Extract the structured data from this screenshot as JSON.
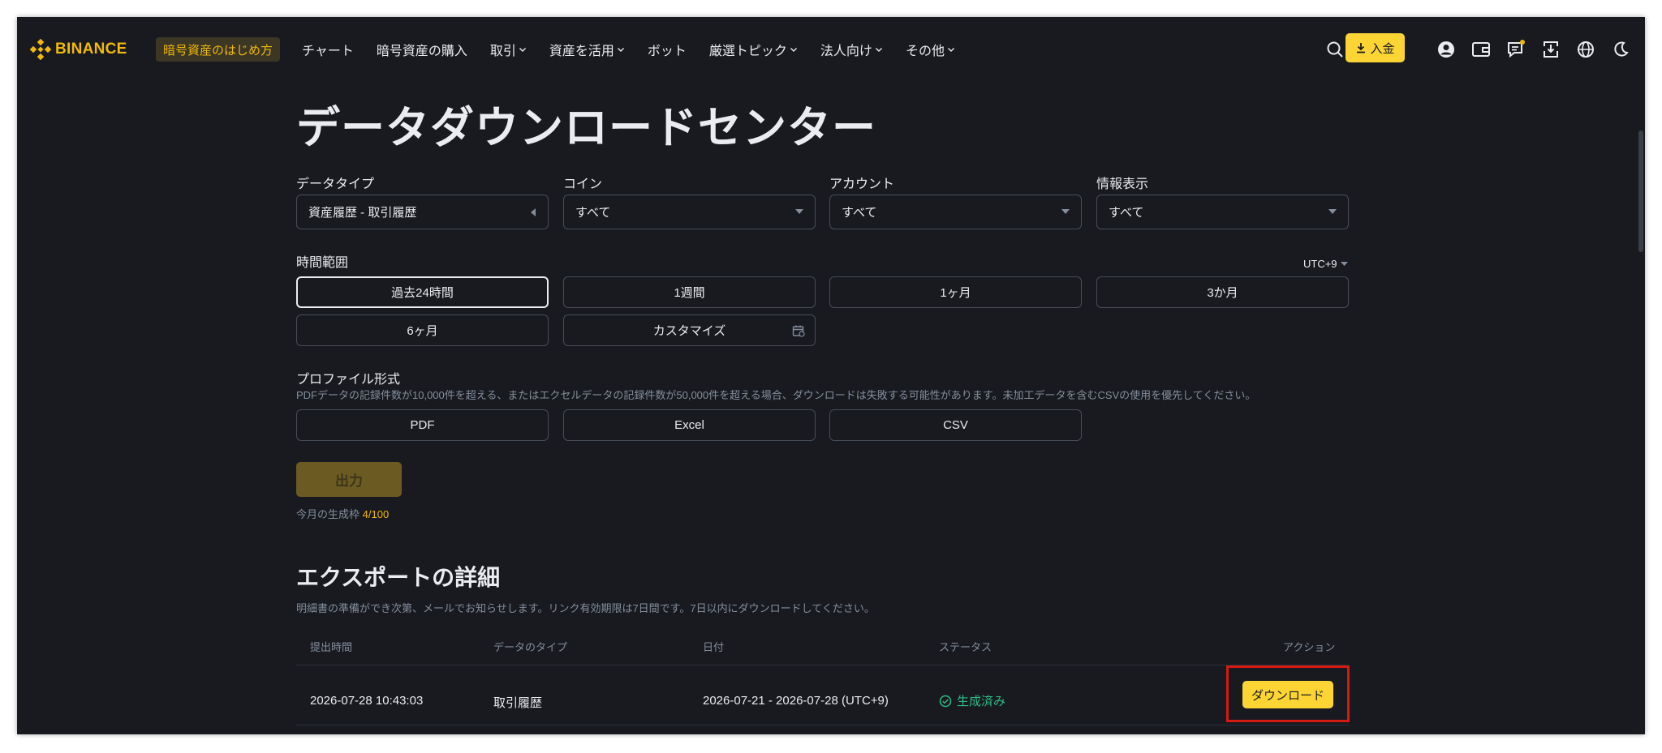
{
  "brand": {
    "name": "BINANCE",
    "color": "#f0b90b"
  },
  "header": {
    "guide_badge": "暗号資産のはじめ方",
    "nav": [
      {
        "label": "チャート",
        "has_chevron": false
      },
      {
        "label": "暗号資産の購入",
        "has_chevron": false
      },
      {
        "label": "取引",
        "has_chevron": true
      },
      {
        "label": "資産を活用",
        "has_chevron": true
      },
      {
        "label": "ボット",
        "has_chevron": false
      },
      {
        "label": "厳選トピック",
        "has_chevron": true
      },
      {
        "label": "法人向け",
        "has_chevron": true
      },
      {
        "label": "その他",
        "has_chevron": true
      }
    ],
    "deposit_label": "入金",
    "icons": [
      "search-icon",
      "deposit-icon",
      "account-icon",
      "wallet-icon",
      "messages-icon",
      "download-icon",
      "globe-icon",
      "theme-icon"
    ]
  },
  "page": {
    "title": "データダウンロードセンター"
  },
  "filters": {
    "data_type": {
      "label": "データタイプ",
      "value": "資産履歴 - 取引履歴"
    },
    "coin": {
      "label": "コイン",
      "value": "すべて"
    },
    "account": {
      "label": "アカウント",
      "value": "すべて"
    },
    "info": {
      "label": "情報表示",
      "value": "すべて"
    }
  },
  "time_range": {
    "label": "時間範囲",
    "timezone": "UTC+9",
    "options": [
      "過去24時間",
      "1週間",
      "1ヶ月",
      "3か月",
      "6ヶ月",
      "カスタマイズ"
    ],
    "selected": "過去24時間"
  },
  "profile_format": {
    "label": "プロファイル形式",
    "hint": "PDFデータの記録件数が10,000件を超える、またはエクセルデータの記録件数が50,000件を超える場合、ダウンロードは失敗する可能性があります。未加工データを含むCSVの使用を優先してください。",
    "options": [
      "PDF",
      "Excel",
      "CSV"
    ]
  },
  "output": {
    "button_label": "出力",
    "quota_label": "今月の生成枠",
    "quota_value": "4/100"
  },
  "export_details": {
    "title": "エクスポートの詳細",
    "hint": "明細書の準備ができ次第、メールでお知らせします。リンク有効期限は7日間です。7日以内にダウンロードしてください。",
    "columns": [
      "提出時間",
      "データのタイプ",
      "日付",
      "ステータス",
      "アクション"
    ],
    "rows": [
      {
        "submitted": "2026-07-28 10:43:03",
        "type": "取引履歴",
        "date": "2026-07-21 - 2026-07-28 (UTC+9)",
        "status": "生成済み",
        "action": "ダウンロード"
      }
    ]
  },
  "colors": {
    "background": "#181a20",
    "accent": "#fcd535",
    "success": "#2ebd85",
    "highlight": "#d41a12"
  }
}
